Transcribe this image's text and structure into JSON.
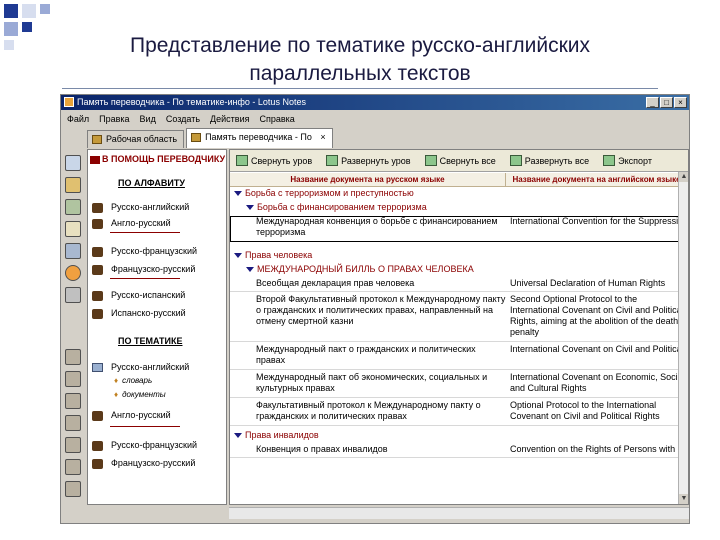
{
  "slide": {
    "title_line1": "Представление по тематике русско-английских",
    "title_line2": "параллельных текстов"
  },
  "window": {
    "title": "Память переводчика - По тематике-инфо - Lotus Notes",
    "buttons": [
      "_",
      "□",
      "×"
    ],
    "menu": [
      "Файл",
      "Правка",
      "Вид",
      "Создать",
      "Действия",
      "Справка"
    ],
    "tabs": [
      {
        "label": "Рабочая область",
        "active": false
      },
      {
        "label": "Память переводчика - По",
        "active": true
      }
    ]
  },
  "nav": {
    "header": "В ПОМОЩЬ ПЕРЕВОДЧИКУ",
    "section_alpha": "ПО АЛФАВИТУ",
    "alpha_items": [
      "Русско-английский",
      "Англо-русский",
      "Русско-французский",
      "Французско-русский",
      "Русско-испанский",
      "Испанско-русский"
    ],
    "section_topic": "ПО ТЕМАТИКЕ",
    "topic_items": [
      "Русско-английский",
      "Англо-русский",
      "Русско-французский",
      "Французско-русский"
    ],
    "topic_sub": [
      "словарь",
      "документы"
    ]
  },
  "actions": [
    "Свернуть уров",
    "Развернуть уров",
    "Свернуть все",
    "Развернуть все",
    "Экспорт"
  ],
  "columns": {
    "ru": "Название документа на русском языке",
    "en": "Название документа на английском языке"
  },
  "categories": {
    "c1": "Борьба с терроризмом и преступностью",
    "c1a": "Борьба с финансированием терроризма",
    "c2": "Права человека",
    "c2a": "МЕЖДУНАРОДНЫЙ БИЛЛЬ О ПРАВАХ ЧЕЛОВЕКА",
    "c3": "Права инвалидов"
  },
  "docs": [
    {
      "ru": "Международная конвенция о борьбе с финансированием терроризма",
      "en": "International Convention for the Suppression of the Financing of Terrorism"
    },
    {
      "ru": "Всеобщая декларация прав человека",
      "en": "Universal Declaration of Human Rights"
    },
    {
      "ru": "Второй Факультативный протокол к Международному пакту о гражданских и политических правах, направленный на отмену смертной казни",
      "en": "Second Optional Protocol to the International Covenant on Civil and Political Rights, aiming at the abolition of the death penalty"
    },
    {
      "ru": "Международный пакт о гражданских и политических правах",
      "en": "International Covenant on Civil and Political Rights"
    },
    {
      "ru": "Международный пакт об экономических, социальных и культурных правах",
      "en": "International Covenant on Economic, Social and Cultural Rights"
    },
    {
      "ru": "Факультативный протокол к Международному пакту о гражданских и политических правах",
      "en": "Optional Protocol to the International Covenant on Civil and Political Rights"
    },
    {
      "ru": "Конвенция о правах инвалидов",
      "en": "Convention on the Rights of Persons with Disabilities"
    }
  ],
  "colors": {
    "title_bar": "#0a246a",
    "accent_red": "#8b0000",
    "nav_bg": "#ffffff"
  }
}
